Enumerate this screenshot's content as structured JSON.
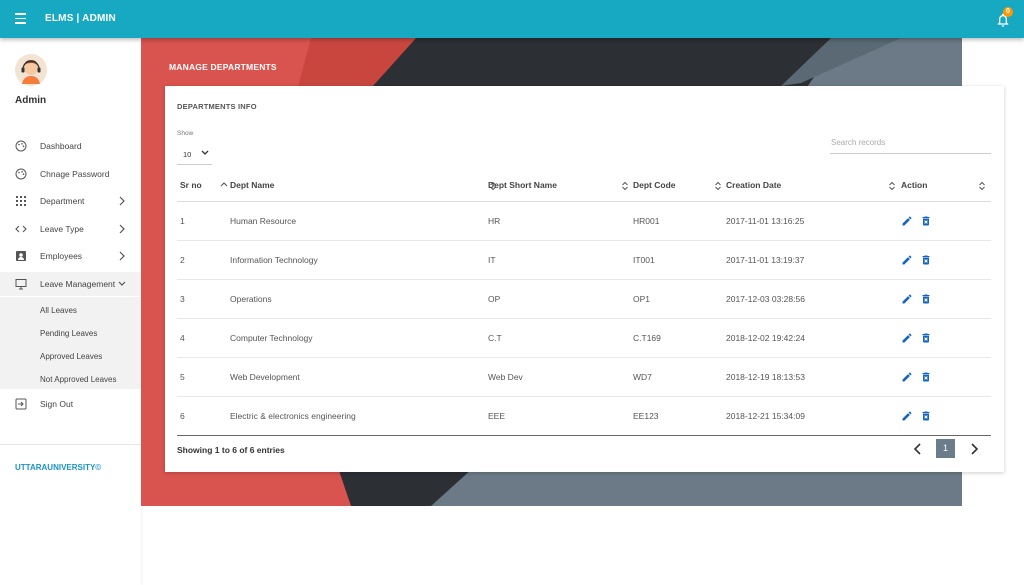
{
  "header": {
    "title": "ELMS | ADMIN",
    "notification_count": "0"
  },
  "sidebar": {
    "user": "Admin",
    "items": [
      {
        "label": "Dashboard",
        "icon": "palette-icon"
      },
      {
        "label": "Chnage Password",
        "icon": "palette-icon"
      },
      {
        "label": "Department",
        "icon": "grid-icon"
      },
      {
        "label": "Leave Type",
        "icon": "code-icon"
      },
      {
        "label": "Employees",
        "icon": "contact-card-icon"
      },
      {
        "label": "Leave Management",
        "icon": "monitor-icon"
      }
    ],
    "leave_submenu": [
      "All Leaves",
      "Pending Leaves",
      "Approved Leaves",
      "Not Approved Leaves"
    ],
    "sign_out": "Sign Out",
    "footer": "UTTARAUNIVERSITY©"
  },
  "page": {
    "title": "MANAGE DEPARTMENTS"
  },
  "card": {
    "title": "DEPARTMENTS INFO",
    "show_label": "Show",
    "show_value": "10",
    "search_placeholder": "Search records",
    "columns": [
      "Sr no",
      "Dept Name",
      "Dept Short Name",
      "Dept Code",
      "Creation Date",
      "Action"
    ],
    "rows": [
      {
        "sr": "1",
        "name": "Human Resource",
        "short": "HR",
        "code": "HR001",
        "date": "2017-11-01 13:16:25"
      },
      {
        "sr": "2",
        "name": "Information Technology",
        "short": "IT",
        "code": "IT001",
        "date": "2017-11-01 13:19:37"
      },
      {
        "sr": "3",
        "name": "Operations",
        "short": "OP",
        "code": "OP1",
        "date": "2017-12-03 03:28:56"
      },
      {
        "sr": "4",
        "name": "Computer Technology",
        "short": "C.T",
        "code": "C.T169",
        "date": "2018-12-02 19:42:24"
      },
      {
        "sr": "5",
        "name": "Web Development",
        "short": "Web Dev",
        "code": "WD7",
        "date": "2018-12-19 18:13:53"
      },
      {
        "sr": "6",
        "name": "Electric & electronics engineering",
        "short": "EEE",
        "code": "EE123",
        "date": "2018-12-21 15:34:09"
      }
    ],
    "footer_text": "Showing 1 to 6 of 6 entries",
    "current_page": "1"
  },
  "colors": {
    "topbar": "#17a9c2",
    "banner_red": "#d9534f",
    "banner_dark": "#2c2f34",
    "banner_slate": "#6b7a86",
    "action_blue": "#1565c0",
    "brand_link": "#1993c9",
    "badge": "#ff9800"
  }
}
